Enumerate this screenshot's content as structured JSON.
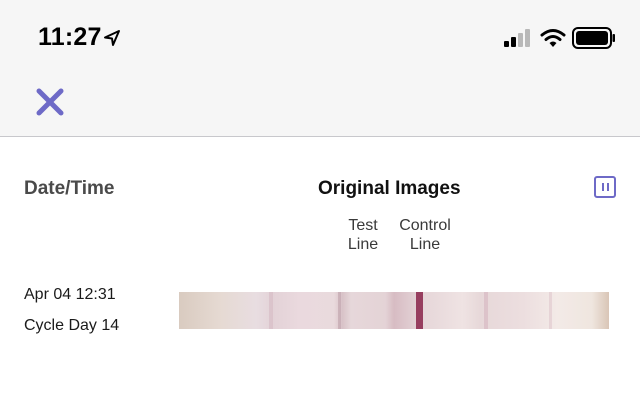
{
  "status_bar": {
    "time": "11:27",
    "icons": [
      "location-arrow-icon",
      "cellular-signal-icon",
      "wifi-icon",
      "battery-icon"
    ]
  },
  "nav": {
    "close_icon": "close-icon",
    "accent_color": "#6e6ac7"
  },
  "table": {
    "columns": {
      "date_time": "Date/Time",
      "original_images": "Original Images"
    },
    "sub_labels": {
      "test": [
        "Test",
        "Line"
      ],
      "control": [
        "Control",
        "Line"
      ]
    },
    "view_toggle_icon": "pause-icon",
    "rows": [
      {
        "date": "Apr 04 12:31",
        "cycle": "Cycle Day 14",
        "strip_image": "test-strip-photo"
      }
    ]
  }
}
